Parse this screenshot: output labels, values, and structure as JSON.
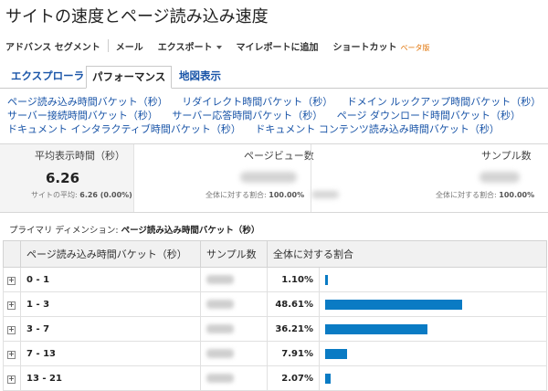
{
  "header": {
    "title": "サイトの速度とページ読み込み速度"
  },
  "toolbar": {
    "advanced_segments": "アドバンス セグメント",
    "email": "メール",
    "export": "エクスポート",
    "add_to_dashboard": "マイレポートに追加",
    "shortcut": "ショートカット",
    "beta": "ベータ版"
  },
  "tabs": [
    {
      "label": "エクスプローラ"
    },
    {
      "label": "パフォーマンス"
    },
    {
      "label": "地図表示"
    }
  ],
  "dimension_links": [
    [
      "ページ読み込み時間バケット（秒）",
      "リダイレクト時間バケット（秒）",
      "ドメイン ルックアップ時間バケット（秒）"
    ],
    [
      "サーバー接続時間バケット（秒）",
      "サーバー応答時間バケット（秒）",
      "ページ ダウンロード時間バケット（秒）"
    ],
    [
      "ドキュメント インタラクティブ時間バケット（秒）",
      "ドキュメント コンテンツ読み込み時間バケット（秒）"
    ]
  ],
  "metrics": {
    "avg_load": {
      "title": "平均表示時間（秒）",
      "value": "6.26",
      "sub_label": "サイトの平均:",
      "sub_value": "6.26 (0.00%)"
    },
    "pageviews": {
      "title": "ページビュー数",
      "sub_label": "全体に対する割合:",
      "sub_value": "100.00%"
    },
    "samples": {
      "title": "サンプル数",
      "sub_label": "全体に対する割合:",
      "sub_value": "100.00%"
    }
  },
  "primary_dimension": {
    "label": "プライマリ ディメンション:",
    "value": "ページ読み込み時間バケット（秒）"
  },
  "table": {
    "columns": [
      "ページ読み込み時間バケット（秒）",
      "サンプル数",
      "全体に対する割合"
    ],
    "rows": [
      {
        "bucket": "0 - 1",
        "pct_label": "1.10%",
        "pct": 1.1
      },
      {
        "bucket": "1 - 3",
        "pct_label": "48.61%",
        "pct": 48.61
      },
      {
        "bucket": "3 - 7",
        "pct_label": "36.21%",
        "pct": 36.21
      },
      {
        "bucket": "7 - 13",
        "pct_label": "7.91%",
        "pct": 7.91
      },
      {
        "bucket": "13 - 21",
        "pct_label": "2.07%",
        "pct": 2.07
      }
    ]
  },
  "colors": {
    "bar": "#0a7bc4",
    "link": "#1a55a8",
    "beta": "#e07000"
  }
}
